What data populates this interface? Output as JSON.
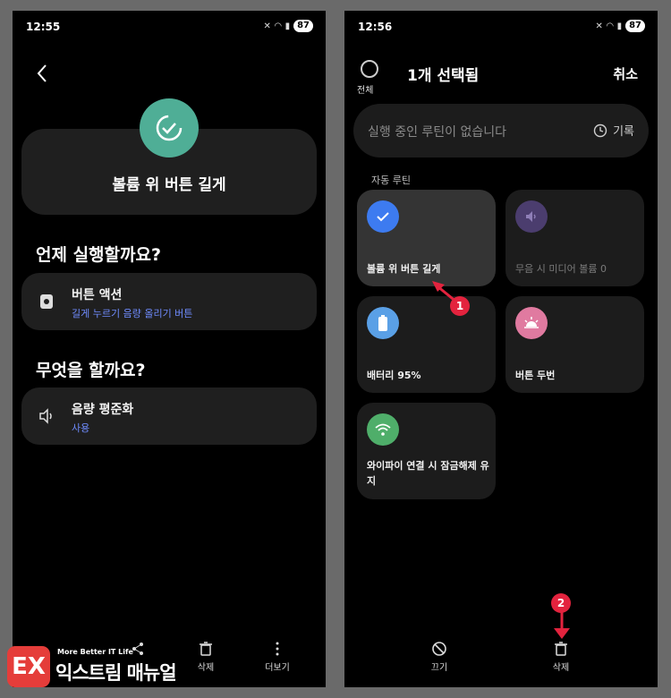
{
  "left": {
    "status": {
      "time": "12:55",
      "battery": "87"
    },
    "routine_title": "볼륨 위 버튼 길게",
    "when_heading": "언제 실행할까요?",
    "trigger": {
      "title": "버튼 액션",
      "subtitle": "길게 누르기 음량 올리기 버튼"
    },
    "do_heading": "무엇을 할까요?",
    "action": {
      "title": "음량 평준화",
      "subtitle": "사용"
    },
    "bottom": {
      "delete": "삭제",
      "more": "더보기"
    }
  },
  "right": {
    "status": {
      "time": "12:56",
      "battery": "87"
    },
    "select_all": "전체",
    "selected_title": "1개 선택됨",
    "cancel": "취소",
    "empty_text": "실행 중인 루틴이 없습니다",
    "history": "기록",
    "auto_label": "자동 루틴",
    "tiles": [
      {
        "label": "볼륨 위 버튼 길게",
        "icon": "check-icon",
        "color": "#3d7bf0"
      },
      {
        "label": "무음 시 미디어 볼륨 0",
        "icon": "speaker-icon",
        "color": "#4b3d6e"
      },
      {
        "label": "배터리 95%",
        "icon": "battery-icon",
        "color": "#5aa0e6"
      },
      {
        "label": "버튼 두번",
        "icon": "sunrise-icon",
        "color": "#e07aa0"
      },
      {
        "label": "와이파이 연결 시 잠금해제 유지",
        "icon": "wifi-icon",
        "color": "#4fae6a"
      }
    ],
    "bottom": {
      "off": "끄기",
      "delete": "삭제"
    },
    "badges": {
      "one": "1",
      "two": "2"
    }
  },
  "watermark": {
    "small": "More Better IT Life",
    "big": "익스트림 매뉴얼",
    "mark": "EX"
  }
}
